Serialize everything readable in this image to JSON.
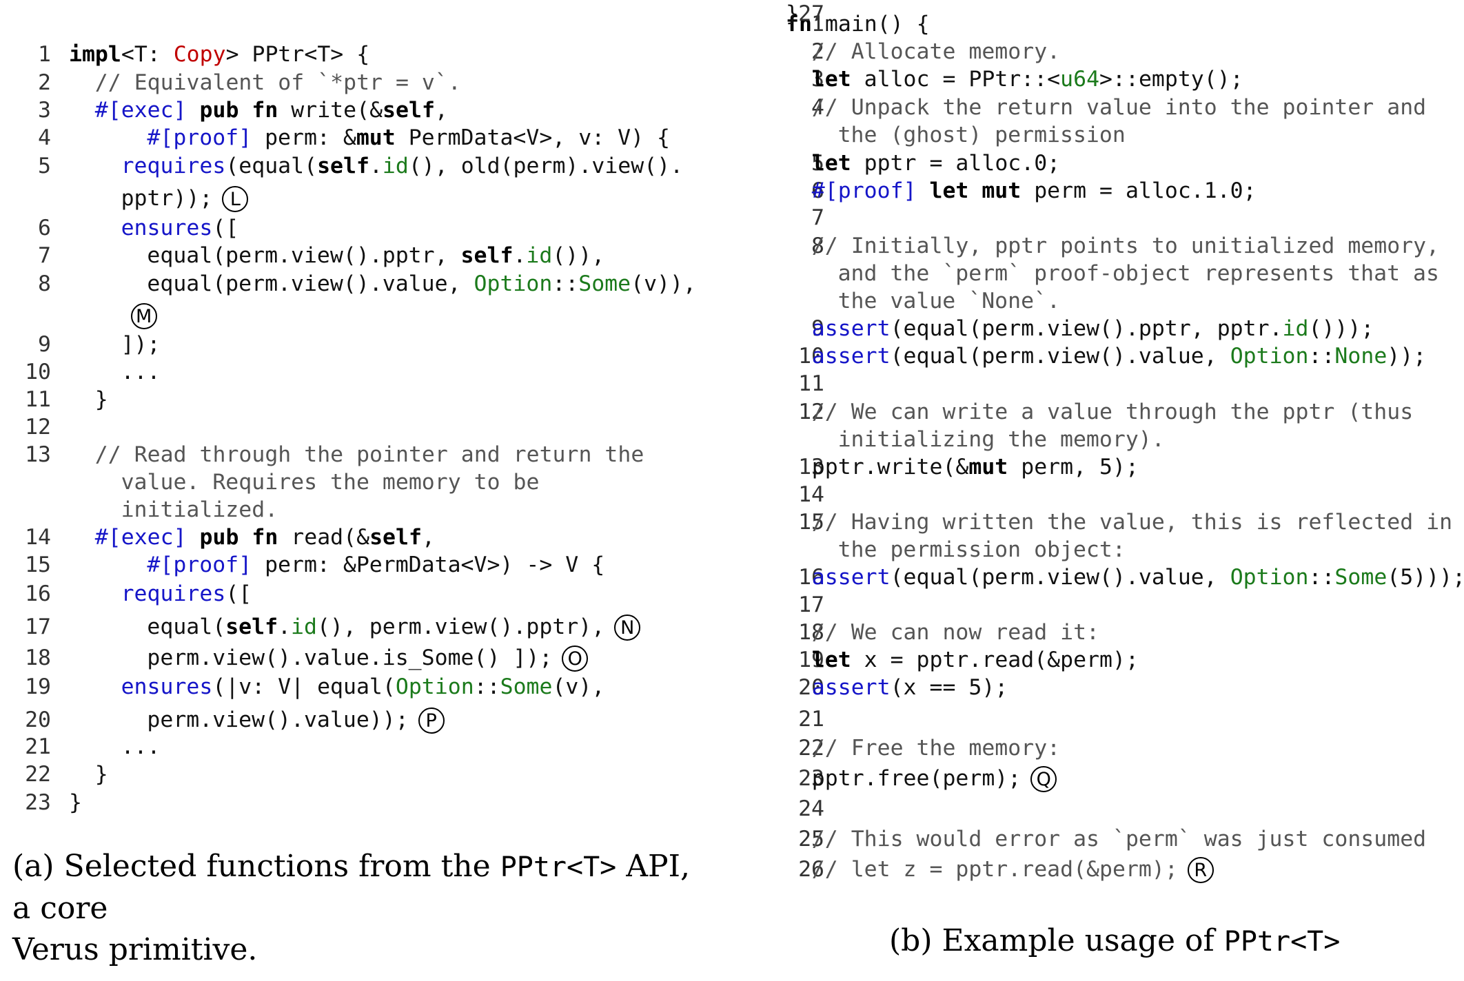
{
  "panel_a": {
    "caption": "(a) Selected functions from the PPtr<T> API, a core Verus primitive.",
    "caption_parts": {
      "prefix": "(a) Selected functions from the ",
      "code": "PPtr<T>",
      "suffix_line1": " API, a core",
      "line2": "Verus primitive."
    },
    "lines": [
      {
        "n": "1",
        "indent": 0,
        "parts": [
          [
            "kw",
            "impl"
          ],
          [
            "n",
            "<T: "
          ],
          [
            "rd",
            "Copy"
          ],
          [
            "n",
            "> PPtr<T> {"
          ]
        ]
      },
      {
        "n": "2",
        "indent": 1,
        "parts": [
          [
            "cm",
            "// Equivalent of `*ptr = v`."
          ]
        ]
      },
      {
        "n": "3",
        "indent": 1,
        "parts": [
          [
            "bl",
            "#[exec]"
          ],
          [
            "n",
            " "
          ],
          [
            "kw",
            "pub fn"
          ],
          [
            "n",
            " write(&"
          ],
          [
            "kw",
            "self"
          ],
          [
            "n",
            ","
          ]
        ]
      },
      {
        "n": "4",
        "indent": 3,
        "parts": [
          [
            "bl",
            "#[proof]"
          ],
          [
            "n",
            " perm: &"
          ],
          [
            "kw",
            "mut"
          ],
          [
            "n",
            " PermData<V>, v: V) {"
          ]
        ]
      },
      {
        "n": "5",
        "indent": 2,
        "parts": [
          [
            "bl",
            "requires"
          ],
          [
            "n",
            "(equal("
          ],
          [
            "kw",
            "self"
          ],
          [
            "n",
            "."
          ],
          [
            "gr",
            "id"
          ],
          [
            "n",
            "(), old(perm).view()."
          ]
        ]
      },
      {
        "n": "",
        "indent": 2,
        "parts": [
          [
            "n",
            "pptr));"
          ]
        ],
        "marker": "L"
      },
      {
        "n": "6",
        "indent": 2,
        "parts": [
          [
            "bl",
            "ensures"
          ],
          [
            "n",
            "(["
          ]
        ]
      },
      {
        "n": "7",
        "indent": 3,
        "parts": [
          [
            "n",
            "equal(perm.view().pptr, "
          ],
          [
            "kw",
            "self"
          ],
          [
            "n",
            "."
          ],
          [
            "gr",
            "id"
          ],
          [
            "n",
            "()),"
          ]
        ]
      },
      {
        "n": "8",
        "indent": 3,
        "parts": [
          [
            "n",
            "equal(perm.view().value, "
          ],
          [
            "gr",
            "Option"
          ],
          [
            "n",
            "::"
          ],
          [
            "gr",
            "Some"
          ],
          [
            "n",
            "(v)),"
          ]
        ]
      },
      {
        "n": "",
        "indent": 2,
        "parts": [],
        "marker": "M"
      },
      {
        "n": "9",
        "indent": 2,
        "parts": [
          [
            "n",
            "]);"
          ]
        ]
      },
      {
        "n": "10",
        "indent": 2,
        "parts": [
          [
            "n",
            "..."
          ]
        ]
      },
      {
        "n": "11",
        "indent": 1,
        "parts": [
          [
            "n",
            "}"
          ]
        ]
      },
      {
        "n": "12",
        "indent": 0,
        "parts": []
      },
      {
        "n": "13",
        "indent": 1,
        "parts": [
          [
            "cm",
            "// Read through the pointer and return the"
          ]
        ]
      },
      {
        "n": "",
        "indent": 2,
        "parts": [
          [
            "cm",
            "value. Requires the memory to be"
          ]
        ]
      },
      {
        "n": "",
        "indent": 2,
        "parts": [
          [
            "cm",
            "initialized."
          ]
        ]
      },
      {
        "n": "14",
        "indent": 1,
        "parts": [
          [
            "bl",
            "#[exec]"
          ],
          [
            "n",
            " "
          ],
          [
            "kw",
            "pub fn"
          ],
          [
            "n",
            " read(&"
          ],
          [
            "kw",
            "self"
          ],
          [
            "n",
            ","
          ]
        ]
      },
      {
        "n": "15",
        "indent": 3,
        "parts": [
          [
            "bl",
            "#[proof]"
          ],
          [
            "n",
            " perm: &PermData<V>) -> V {"
          ]
        ]
      },
      {
        "n": "16",
        "indent": 2,
        "parts": [
          [
            "bl",
            "requires"
          ],
          [
            "n",
            "(["
          ]
        ]
      },
      {
        "n": "17",
        "indent": 3,
        "parts": [
          [
            "n",
            "equal("
          ],
          [
            "kw",
            "self"
          ],
          [
            "n",
            "."
          ],
          [
            "gr",
            "id"
          ],
          [
            "n",
            "(), perm.view().pptr),"
          ]
        ],
        "marker": "N"
      },
      {
        "n": "18",
        "indent": 3,
        "parts": [
          [
            "n",
            "perm.view().value.is_Some() ]);"
          ]
        ],
        "marker": "O"
      },
      {
        "n": "19",
        "indent": 2,
        "parts": [
          [
            "bl",
            "ensures"
          ],
          [
            "n",
            "(|v: V| equal("
          ],
          [
            "gr",
            "Option"
          ],
          [
            "n",
            "::"
          ],
          [
            "gr",
            "Some"
          ],
          [
            "n",
            "(v),"
          ]
        ]
      },
      {
        "n": "20",
        "indent": 3,
        "parts": [
          [
            "n",
            "perm.view().value));"
          ]
        ],
        "marker": "P"
      },
      {
        "n": "21",
        "indent": 2,
        "parts": [
          [
            "n",
            "..."
          ]
        ]
      },
      {
        "n": "22",
        "indent": 1,
        "parts": [
          [
            "n",
            "}"
          ]
        ]
      },
      {
        "n": "23",
        "indent": 0,
        "parts": [
          [
            "n",
            "}"
          ]
        ]
      }
    ]
  },
  "panel_b": {
    "caption": "(b) Example usage of PPtr<T>",
    "caption_parts": {
      "prefix": "(b) Example usage of ",
      "code": "PPtr<T>"
    },
    "lines": [
      {
        "n": "1",
        "indent": 0,
        "parts": [
          [
            "kw",
            "fn"
          ],
          [
            "n",
            " main() {"
          ]
        ]
      },
      {
        "n": "2",
        "indent": 1,
        "parts": [
          [
            "cm",
            "// Allocate memory."
          ]
        ]
      },
      {
        "n": "3",
        "indent": 1,
        "parts": [
          [
            "kw",
            "let"
          ],
          [
            "n",
            " alloc = PPtr::<"
          ],
          [
            "gr",
            "u64"
          ],
          [
            "n",
            ">::empty();"
          ]
        ]
      },
      {
        "n": "4",
        "indent": 1,
        "parts": [
          [
            "cm",
            "// Unpack the return value into the pointer and"
          ]
        ]
      },
      {
        "n": "",
        "indent": 2,
        "parts": [
          [
            "cm",
            "the (ghost) permission"
          ]
        ]
      },
      {
        "n": "5",
        "indent": 1,
        "parts": [
          [
            "kw",
            "let"
          ],
          [
            "n",
            " pptr = alloc.0;"
          ]
        ]
      },
      {
        "n": "6",
        "indent": 1,
        "parts": [
          [
            "bl",
            "#[proof]"
          ],
          [
            "n",
            " "
          ],
          [
            "kw",
            "let mut"
          ],
          [
            "n",
            " perm = alloc.1.0;"
          ]
        ]
      },
      {
        "n": "7",
        "indent": 0,
        "parts": []
      },
      {
        "n": "8",
        "indent": 1,
        "parts": [
          [
            "cm",
            "// Initially, pptr points to unitialized memory,"
          ]
        ]
      },
      {
        "n": "",
        "indent": 2,
        "parts": [
          [
            "cm",
            "and the `perm` proof-object represents that as"
          ]
        ]
      },
      {
        "n": "",
        "indent": 2,
        "parts": [
          [
            "cm",
            "the value `None`."
          ]
        ]
      },
      {
        "n": "9",
        "indent": 1,
        "parts": [
          [
            "bl",
            "assert"
          ],
          [
            "n",
            "(equal(perm.view().pptr, pptr."
          ],
          [
            "gr",
            "id"
          ],
          [
            "n",
            "()));"
          ]
        ]
      },
      {
        "n": "10",
        "indent": 1,
        "parts": [
          [
            "bl",
            "assert"
          ],
          [
            "n",
            "(equal(perm.view().value, "
          ],
          [
            "gr",
            "Option"
          ],
          [
            "n",
            "::"
          ],
          [
            "gr",
            "None"
          ],
          [
            "n",
            "));"
          ]
        ]
      },
      {
        "n": "11",
        "indent": 0,
        "parts": []
      },
      {
        "n": "12",
        "indent": 1,
        "parts": [
          [
            "cm",
            "// We can write a value through the pptr (thus"
          ]
        ]
      },
      {
        "n": "",
        "indent": 2,
        "parts": [
          [
            "cm",
            "initializing the memory)."
          ]
        ]
      },
      {
        "n": "13",
        "indent": 1,
        "parts": [
          [
            "n",
            "pptr.write(&"
          ],
          [
            "kw",
            "mut"
          ],
          [
            "n",
            " perm, 5);"
          ]
        ]
      },
      {
        "n": "14",
        "indent": 0,
        "parts": []
      },
      {
        "n": "15",
        "indent": 1,
        "parts": [
          [
            "cm",
            "// Having written the value, this is reflected in"
          ]
        ]
      },
      {
        "n": "",
        "indent": 2,
        "parts": [
          [
            "cm",
            "the permission object:"
          ]
        ]
      },
      {
        "n": "16",
        "indent": 1,
        "parts": [
          [
            "bl",
            "assert"
          ],
          [
            "n",
            "(equal(perm.view().value, "
          ],
          [
            "gr",
            "Option"
          ],
          [
            "n",
            "::"
          ],
          [
            "gr",
            "Some"
          ],
          [
            "n",
            "(5)));"
          ]
        ]
      },
      {
        "n": "17",
        "indent": 0,
        "parts": []
      },
      {
        "n": "18",
        "indent": 1,
        "parts": [
          [
            "cm",
            "// We can now read it:"
          ]
        ]
      },
      {
        "n": "19",
        "indent": 1,
        "parts": [
          [
            "kw",
            "let"
          ],
          [
            "n",
            " x = pptr.read(&perm);"
          ]
        ]
      },
      {
        "n": "20",
        "indent": 1,
        "parts": [
          [
            "bl",
            "assert"
          ],
          [
            "n",
            "(x == 5);"
          ]
        ]
      },
      {
        "n": "21",
        "indent": 0,
        "parts": []
      },
      {
        "n": "22",
        "indent": 1,
        "parts": [
          [
            "cm",
            "// Free the memory:"
          ]
        ]
      },
      {
        "n": "23",
        "indent": 1,
        "parts": [
          [
            "n",
            "pptr.free(perm);"
          ]
        ],
        "marker": "Q"
      },
      {
        "n": "24",
        "indent": 0,
        "parts": []
      },
      {
        "n": "25",
        "indent": 1,
        "parts": [
          [
            "cm",
            "// This would error as `perm` was just consumed"
          ]
        ]
      },
      {
        "n": "26",
        "indent": 1,
        "parts": [
          [
            "cm",
            "// let z = pptr.read(&perm);"
          ]
        ],
        "marker": "R"
      },
      {
        "n": "27",
        "indent": 0,
        "parts": [
          [
            "n",
            "}"
          ]
        ]
      }
    ]
  }
}
